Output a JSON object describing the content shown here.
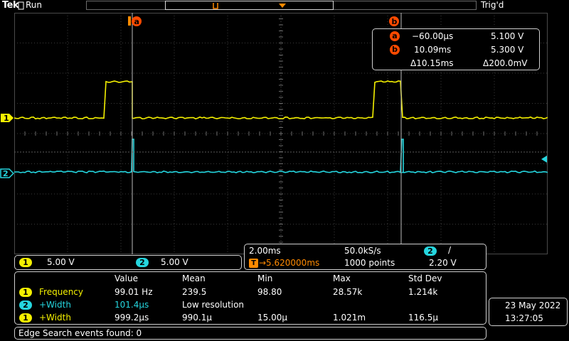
{
  "header": {
    "brand": "Tek",
    "run_state": "Run",
    "trigger_state": "Trig'd"
  },
  "cursors": {
    "a_label": "a",
    "b_label": "b",
    "a_time": "−60.00µs",
    "a_value": "5.100 V",
    "b_time": "10.09ms",
    "b_value": "5.300 V",
    "delta_time": "Δ10.15ms",
    "delta_value": "Δ200.0mV"
  },
  "channels": {
    "ch1_label": "1",
    "ch2_label": "2",
    "ch1_scale": "5.00 V",
    "ch2_scale": "5.00 V",
    "ch1_color": "#f4f000",
    "ch2_color": "#25d6df"
  },
  "horizontal": {
    "time_div": "2.00ms",
    "sample_rate": "50.0kS/s",
    "trigger_source": "2",
    "trigger_slope_glyph": "/",
    "trigger_level": "2.20 V",
    "trigger_glyph": "T",
    "trigger_position": "→5.620000ms",
    "record_length": "1000 points"
  },
  "measurements": {
    "headers": [
      "Value",
      "Mean",
      "Min",
      "Max",
      "Std Dev"
    ],
    "rows": [
      {
        "source": "1",
        "name": "Frequency",
        "value": "99.01 Hz",
        "mean": "239.5",
        "min": "98.80",
        "max": "28.57k",
        "std": "1.214k"
      },
      {
        "source": "2",
        "name": "+Width",
        "value": "101.4µs",
        "mean": "Low resolution",
        "min": "",
        "max": "",
        "std": ""
      },
      {
        "source": "1",
        "name": "+Width",
        "value": "999.2µs",
        "mean": "990.1µ",
        "min": "15.00µ",
        "max": "1.021m",
        "std": "116.5µ"
      }
    ]
  },
  "datetime": {
    "date": "23 May 2022",
    "time": "13:27:05"
  },
  "status": {
    "message": "Edge Search events found: 0"
  }
}
